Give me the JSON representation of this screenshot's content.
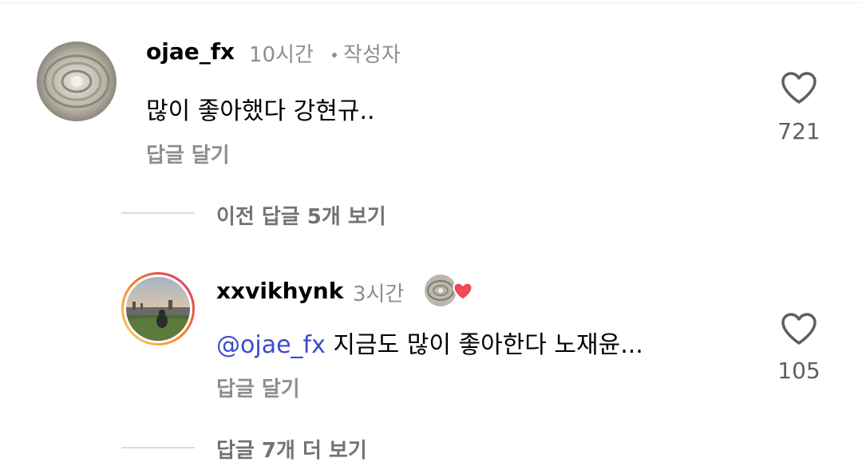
{
  "comments": [
    {
      "username": "ojae_fx",
      "time": "10시간",
      "author_badge": "작성자",
      "text": "많이 좋아했다 강현규..",
      "reply_label": "답글 달기",
      "likes": "721",
      "replies_toggle": "이전 답글 5개 보기"
    },
    {
      "username": "xxvikhynk",
      "time": "3시간",
      "mention": "@ojae_fx",
      "text": " 지금도 많이 좋아한다 노재윤...",
      "reply_label": "답글 달기",
      "likes": "105",
      "liked_by_author": true,
      "replies_toggle": "답글 7개 더 보기"
    }
  ],
  "colors": {
    "mention": "#3b4cca",
    "meta": "#8e8e8e",
    "heart_red": "#ed4956",
    "story_ring_start": "#feda75",
    "story_ring_end": "#d62976"
  },
  "icons": {
    "like": "heart-outline-icon",
    "author_like": "heart-filled-icon"
  }
}
